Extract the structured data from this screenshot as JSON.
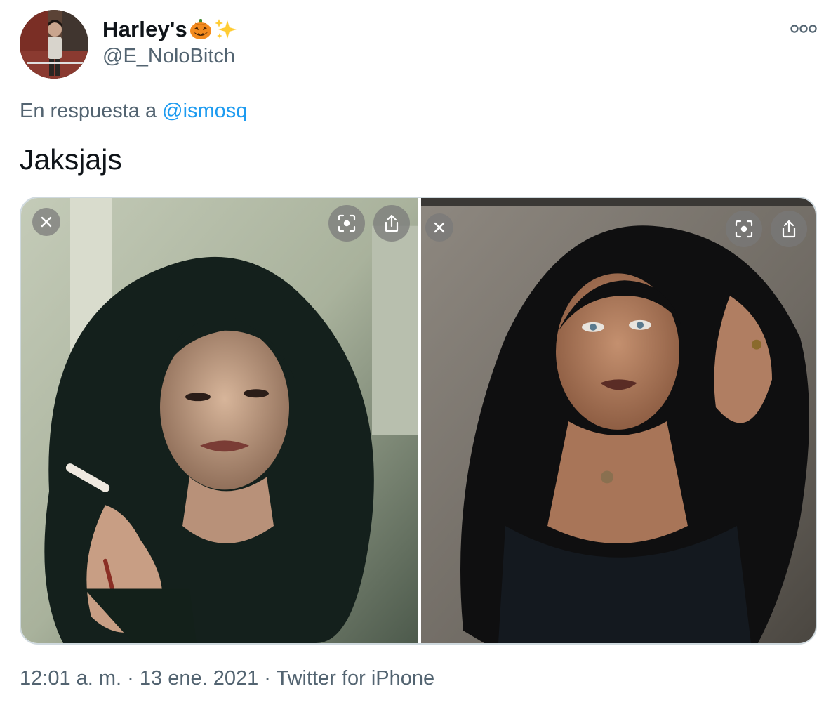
{
  "author": {
    "display_name": "Harley's",
    "handle": "@E_NoloBitch"
  },
  "reply": {
    "prefix": "En respuesta a",
    "mention": "@ismosq"
  },
  "tweet": {
    "text": "Jaksjajs"
  },
  "media": {
    "count": 2
  },
  "meta": {
    "time": "12:01 a. m.",
    "separator": "·",
    "date": "13 ene. 2021",
    "source": "Twitter for iPhone"
  },
  "colors": {
    "text_primary": "#0f1419",
    "text_secondary": "#536471",
    "link": "#1d9bf0",
    "border": "#cfd9de"
  },
  "icons": {
    "more": "more-horizontal-icon",
    "close": "close-icon",
    "lens": "visual-search-icon",
    "share": "share-icon"
  }
}
